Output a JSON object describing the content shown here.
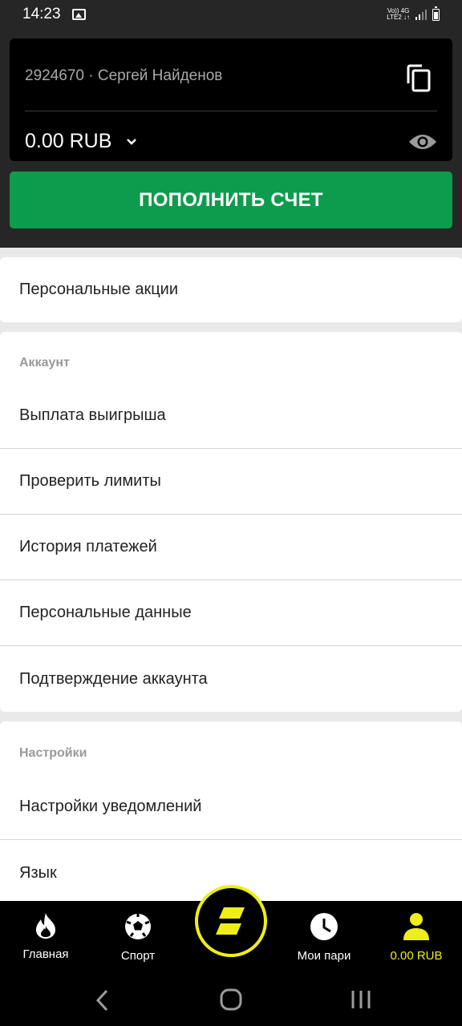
{
  "status_bar": {
    "time": "14:23",
    "network_line1": "Vo)) 4G",
    "network_line2": "LTE2 ↓↑"
  },
  "account": {
    "id_name": "2924670 · Сергей Найденов",
    "balance": "0.00 RUB",
    "deposit_label": "ПОПОЛНИТЬ СЧЕТ"
  },
  "menu": {
    "promos": "Персональные акции",
    "account_section": "Аккаунт",
    "account_items": [
      "Выплата выигрыша",
      "Проверить лимиты",
      "История платежей",
      "Персональные данные",
      "Подтверждение аккаунта"
    ],
    "settings_section": "Настройки",
    "settings_items": [
      "Настройки уведомлений",
      "Язык"
    ]
  },
  "bottom_nav": {
    "home": "Главная",
    "sport": "Спорт",
    "my_bets": "Мои пари",
    "balance": "0.00 RUB"
  },
  "colors": {
    "accent_green": "#0d9c4d",
    "brand_yellow": "#eeee1a",
    "header_bg": "#262626"
  }
}
